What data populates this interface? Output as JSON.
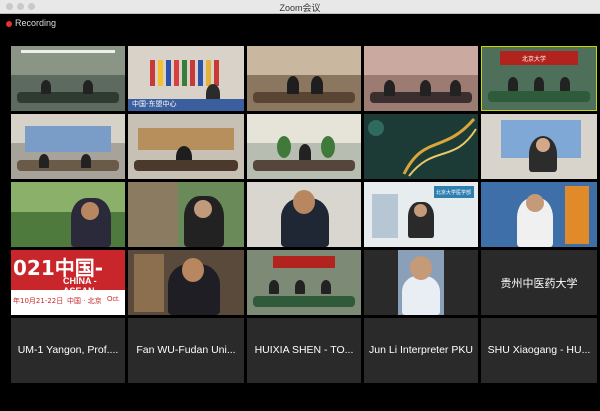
{
  "window": {
    "title": "Zoom会议"
  },
  "recording": {
    "label": "Recording"
  },
  "tiles": {
    "r1c2_caption": "中国-东盟中心",
    "r1c5_banner": "北京大学",
    "r3c4_banner": "北京大学医学部",
    "r4c1_banner": "021中国-",
    "r4c1_banner2": "CHINA - ASEAN",
    "r4c1_date": "年10月21-22日",
    "r4c1_city": "中国 · 北京",
    "r4c1_oct": "Oct.",
    "r4c5_name": "贵州中医药大学"
  },
  "names": [
    "UM-1 Yangon, Prof....",
    "Fan WU-Fudan Uni...",
    "HUIXIA SHEN - TO...",
    "Jun Li Interpreter PKU",
    "SHU Xiaogang - HU..."
  ],
  "colors": {
    "recording": "#e8312f",
    "tile_bg": "#2a2a2a"
  }
}
